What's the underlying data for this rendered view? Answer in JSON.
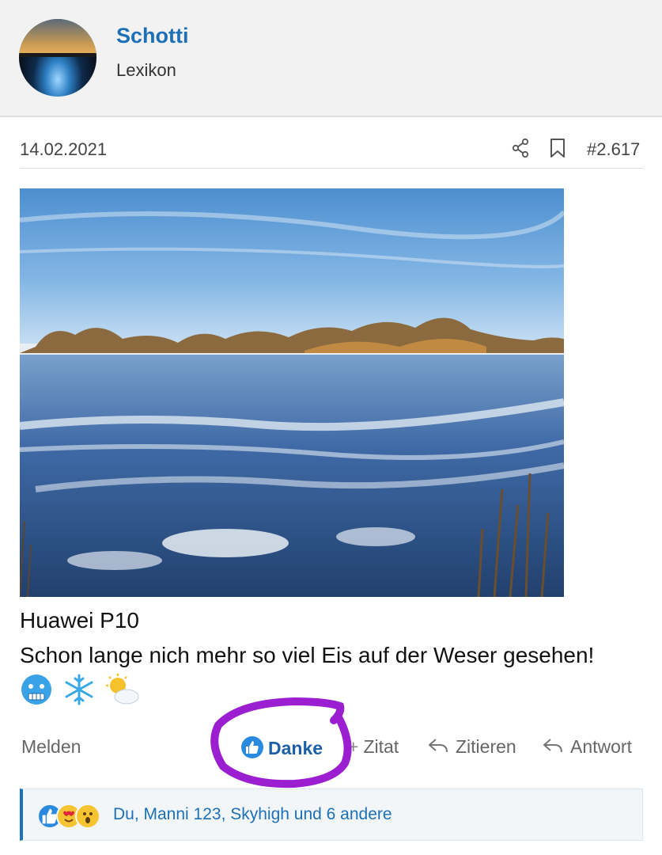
{
  "user": {
    "name": "Schotti",
    "title": "Lexikon"
  },
  "post": {
    "date": "14.02.2021",
    "number": "#2.617",
    "line1": "Huawei P10",
    "line2": "Schon lange nich mehr so viel Eis auf der Weser gesehen!",
    "emojis": [
      "cold-face-emoji",
      "snowflake-emoji",
      "sun-behind-cloud-emoji"
    ]
  },
  "actions": {
    "report": "Melden",
    "thanks": "Danke",
    "quote": "Zitat",
    "cite": "Zitieren",
    "reply": "Antwort"
  },
  "reactions": {
    "icons": [
      "like-reaction-icon",
      "love-reaction-icon",
      "wow-reaction-icon"
    ],
    "text": "Du, Manni 123, Skyhigh und 6 andere"
  },
  "colors": {
    "accent": "#1c70b8",
    "annotation": "#9b1fd1"
  }
}
